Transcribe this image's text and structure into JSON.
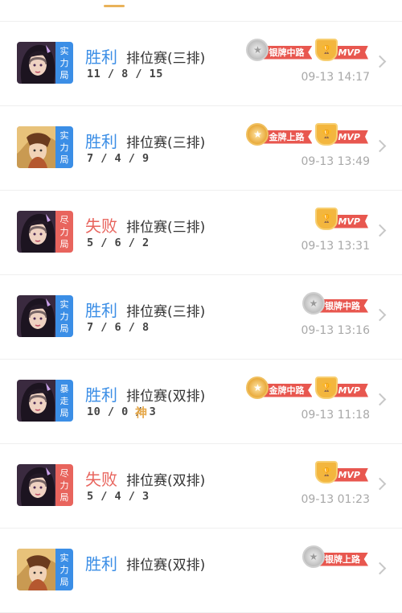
{
  "colors": {
    "win": "#3b8ee6",
    "lose": "#e8645d",
    "accent": "#e9b25a",
    "time": "#a8a8a8"
  },
  "matches": [
    {
      "tag": [
        "实",
        "力",
        "局"
      ],
      "tag_color": "blue",
      "hero": "dark",
      "result": "胜利",
      "result_type": "win",
      "mode": "排位赛(三排)",
      "kda": "11 / 8 / 15",
      "extra": "",
      "badges": [
        {
          "kind": "silver",
          "icon": "star-medal-icon",
          "label": "银牌中路"
        },
        {
          "kind": "mvp",
          "icon": "trophy-icon",
          "label": "MVP"
        }
      ],
      "time": "09-13 14:17"
    },
    {
      "tag": [
        "实",
        "力",
        "局"
      ],
      "tag_color": "blue",
      "hero": "gold",
      "result": "胜利",
      "result_type": "win",
      "mode": "排位赛(三排)",
      "kda": "7 / 4 / 9",
      "extra": "",
      "badges": [
        {
          "kind": "gold",
          "icon": "star-medal-icon",
          "label": "金牌上路"
        },
        {
          "kind": "mvp",
          "icon": "trophy-icon",
          "label": "MVP"
        }
      ],
      "time": "09-13 13:49"
    },
    {
      "tag": [
        "尽",
        "力",
        "局"
      ],
      "tag_color": "red",
      "hero": "dark",
      "result": "失败",
      "result_type": "lose",
      "mode": "排位赛(三排)",
      "kda": "5 / 6 / 2",
      "extra": "",
      "badges": [
        {
          "kind": "mvp",
          "icon": "trophy-icon",
          "label": "MVP"
        }
      ],
      "time": "09-13 13:31"
    },
    {
      "tag": [
        "实",
        "力",
        "局"
      ],
      "tag_color": "blue",
      "hero": "dark",
      "result": "胜利",
      "result_type": "win",
      "mode": "排位赛(三排)",
      "kda": "7 / 6 / 8",
      "extra": "",
      "badges": [
        {
          "kind": "silver",
          "icon": "star-medal-icon",
          "label": "银牌中路"
        }
      ],
      "time": "09-13 13:16"
    },
    {
      "tag": [
        "暴",
        "走",
        "局"
      ],
      "tag_color": "blue",
      "hero": "dark",
      "result": "胜利",
      "result_type": "win",
      "mode": "排位赛(双排)",
      "kda": "10 / 0 / 3",
      "extra": "神",
      "badges": [
        {
          "kind": "gold",
          "icon": "star-medal-icon",
          "label": "金牌中路"
        },
        {
          "kind": "mvp",
          "icon": "trophy-icon",
          "label": "MVP"
        }
      ],
      "time": "09-13 11:18"
    },
    {
      "tag": [
        "尽",
        "力",
        "局"
      ],
      "tag_color": "red",
      "hero": "dark",
      "result": "失败",
      "result_type": "lose",
      "mode": "排位赛(双排)",
      "kda": "5 / 4 / 3",
      "extra": "",
      "badges": [
        {
          "kind": "mvp",
          "icon": "trophy-icon",
          "label": "MVP"
        }
      ],
      "time": "09-13 01:23"
    },
    {
      "tag": [
        "实",
        "力",
        "局"
      ],
      "tag_color": "blue",
      "hero": "gold",
      "result": "胜利",
      "result_type": "win",
      "mode": "排位赛(双排)",
      "kda": "",
      "extra": "",
      "badges": [
        {
          "kind": "silver",
          "icon": "star-medal-icon",
          "label": "银牌上路"
        }
      ],
      "time": ""
    }
  ]
}
